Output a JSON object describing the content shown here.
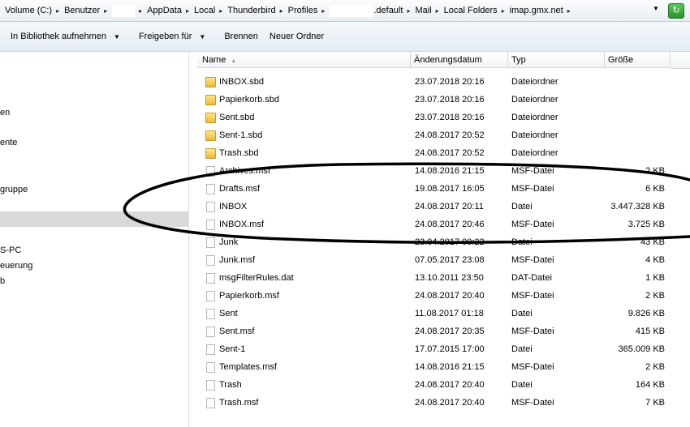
{
  "address": {
    "crumbs": [
      "Volume (C:)",
      "Benutzer",
      "",
      "AppData",
      "Local",
      "Thunderbird",
      "Profiles",
      "",
      ".default",
      "Mail",
      "Local Folders",
      "imap.gmx.net"
    ]
  },
  "toolbar": {
    "library_label": "In Bibliothek aufnehmen",
    "share_label": "Freigeben für",
    "burn_label": "Brennen",
    "new_folder_label": "Neuer Ordner"
  },
  "nav": {
    "items": [
      "en",
      "ente",
      "gruppe",
      "",
      "S-PC",
      "euerung",
      "b"
    ]
  },
  "columns": {
    "name": "Name",
    "date": "Änderungsdatum",
    "type": "Typ",
    "size": "Größe"
  },
  "files": [
    {
      "name": "INBOX.sbd",
      "date": "23.07.2018 20:16",
      "type": "Dateiordner",
      "size": "",
      "icon": "folder-icon"
    },
    {
      "name": "Papierkorb.sbd",
      "date": "23.07.2018 20:16",
      "type": "Dateiordner",
      "size": "",
      "icon": "folder-icon"
    },
    {
      "name": "Sent.sbd",
      "date": "23.07.2018 20:16",
      "type": "Dateiordner",
      "size": "",
      "icon": "folder-icon"
    },
    {
      "name": "Sent-1.sbd",
      "date": "24.08.2017 20:52",
      "type": "Dateiordner",
      "size": "",
      "icon": "folder-icon"
    },
    {
      "name": "Trash.sbd",
      "date": "24.08.2017 20:52",
      "type": "Dateiordner",
      "size": "",
      "icon": "folder-icon"
    },
    {
      "name": "Archives.msf",
      "date": "14.08.2016 21:15",
      "type": "MSF-Datei",
      "size": "2 KB",
      "icon": "file-icon"
    },
    {
      "name": "Drafts.msf",
      "date": "19.08.2017 16:05",
      "type": "MSF-Datei",
      "size": "6 KB",
      "icon": "file-icon"
    },
    {
      "name": "INBOX",
      "date": "24.08.2017 20:11",
      "type": "Datei",
      "size": "3.447.328 KB",
      "icon": "file-icon"
    },
    {
      "name": "INBOX.msf",
      "date": "24.08.2017 20:46",
      "type": "MSF-Datei",
      "size": "3.725 KB",
      "icon": "file-icon"
    },
    {
      "name": "Junk",
      "date": "23.04.2017 00:22",
      "type": "Datei",
      "size": "43 KB",
      "icon": "file-icon"
    },
    {
      "name": "Junk.msf",
      "date": "07.05.2017 23:08",
      "type": "MSF-Datei",
      "size": "4 KB",
      "icon": "file-icon"
    },
    {
      "name": "msgFilterRules.dat",
      "date": "13.10.2011 23:50",
      "type": "DAT-Datei",
      "size": "1 KB",
      "icon": "file-icon"
    },
    {
      "name": "Papierkorb.msf",
      "date": "24.08.2017 20:40",
      "type": "MSF-Datei",
      "size": "2 KB",
      "icon": "file-icon"
    },
    {
      "name": "Sent",
      "date": "11.08.2017 01:18",
      "type": "Datei",
      "size": "9.826 KB",
      "icon": "file-icon"
    },
    {
      "name": "Sent.msf",
      "date": "24.08.2017 20:35",
      "type": "MSF-Datei",
      "size": "415 KB",
      "icon": "file-icon"
    },
    {
      "name": "Sent-1",
      "date": "17.07.2015 17:00",
      "type": "Datei",
      "size": "365.009 KB",
      "icon": "file-icon"
    },
    {
      "name": "Templates.msf",
      "date": "14.08.2016 21:15",
      "type": "MSF-Datei",
      "size": "2 KB",
      "icon": "file-icon"
    },
    {
      "name": "Trash",
      "date": "24.08.2017 20:40",
      "type": "Datei",
      "size": "164 KB",
      "icon": "file-icon"
    },
    {
      "name": "Trash.msf",
      "date": "24.08.2017 20:40",
      "type": "MSF-Datei",
      "size": "7 KB",
      "icon": "file-icon"
    }
  ]
}
